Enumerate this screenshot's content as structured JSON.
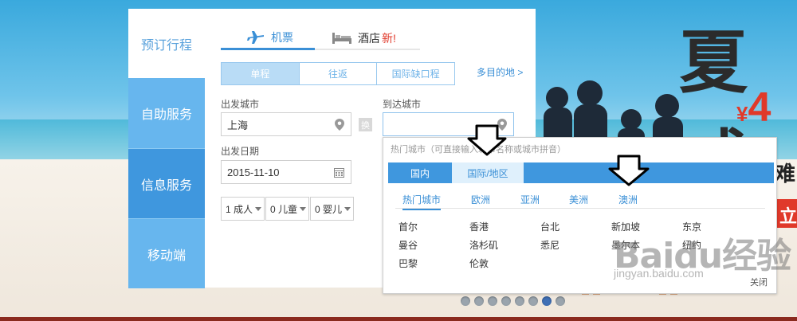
{
  "background": {
    "promo_big": "夏威",
    "promo_price_symbol": "¥",
    "promo_price": "4",
    "promo_side": "难",
    "promo_tag": "立"
  },
  "leftnav": {
    "title": "预订行程",
    "items": [
      {
        "label": "自助服务",
        "active": false
      },
      {
        "label": "信息服务",
        "active": true
      },
      {
        "label": "移动端",
        "active": false
      }
    ]
  },
  "tabs": {
    "flight": "机票",
    "hotel": "酒店",
    "hotel_badge": "新!"
  },
  "trip_types": [
    {
      "label": "单程",
      "active": true
    },
    {
      "label": "往返",
      "active": false
    },
    {
      "label": "国际缺口程",
      "active": false
    }
  ],
  "multi_link": "多目的地 >",
  "form": {
    "depart_city_label": "出发城市",
    "depart_city_value": "上海",
    "arrive_city_label": "到达城市",
    "arrive_city_value": "",
    "swap_label": "换",
    "depart_date_label": "出发日期",
    "depart_date_value": "2015-11-10",
    "adults": "1 成人",
    "children": "0 儿童",
    "infants": "0 婴儿"
  },
  "city_popup": {
    "hint": "热门城市（可直接输入城市名称或城市拼音）",
    "tabs": [
      "国内",
      "国际/地区"
    ],
    "regions": [
      "热门城市",
      "欧洲",
      "亚洲",
      "美洲",
      "澳洲"
    ],
    "cities": [
      "首尔",
      "香港",
      "台北",
      "新加坡",
      "东京",
      "曼谷",
      "洛杉矶",
      "悉尼",
      "墨尔本",
      "纽约",
      "巴黎",
      "伦敦"
    ],
    "close": "关闭"
  },
  "carousel": {
    "count": 8,
    "active_index": 6
  },
  "watermark": {
    "text": "Baidu经验",
    "sub": "jingyan.baidu.com"
  },
  "colors": {
    "accent": "#3f97de",
    "nav": "#67b6ee",
    "promo_red": "#e0392a"
  },
  "icons": [
    "plane-icon",
    "bed-icon",
    "location-pin-icon",
    "calendar-icon",
    "caret-down-icon",
    "down-arrow-annotation-icon"
  ]
}
